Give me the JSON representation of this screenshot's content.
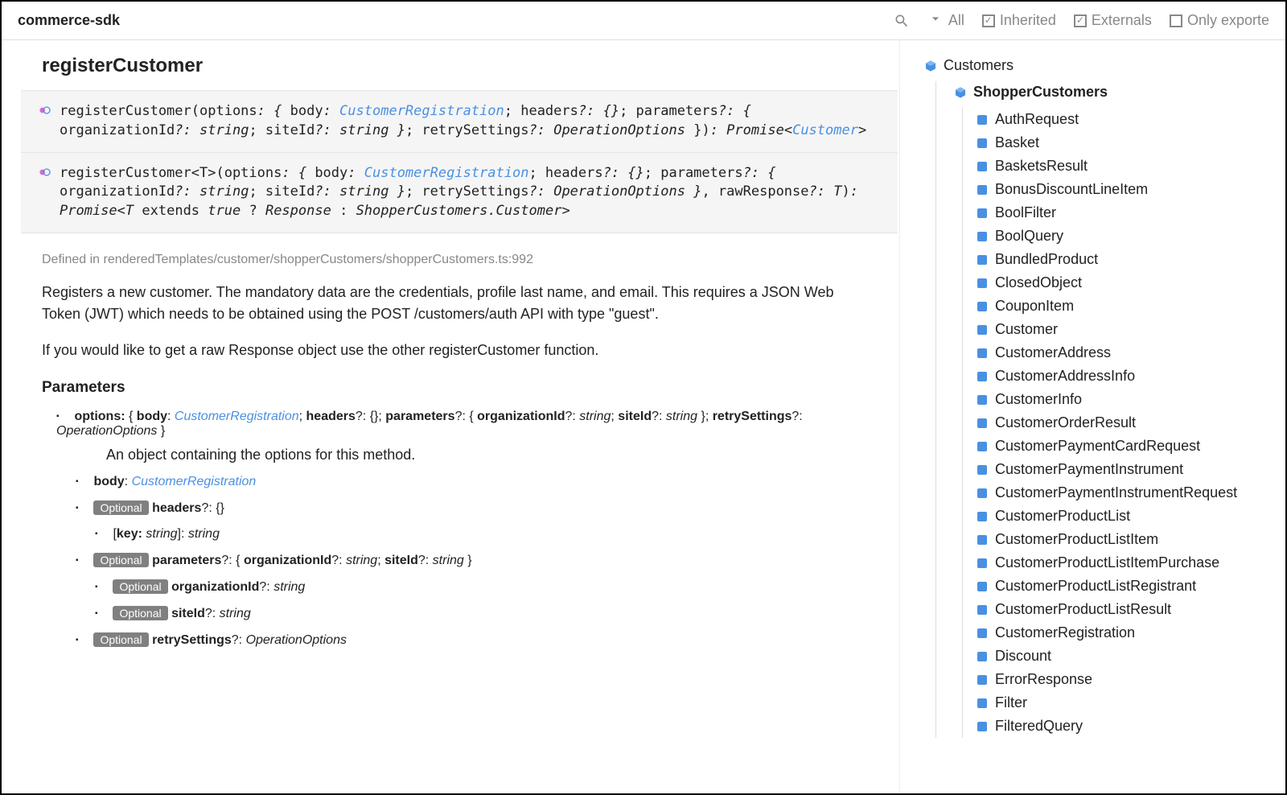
{
  "header": {
    "title": "commerce-sdk",
    "filter_all": "All",
    "filter_inherited": "Inherited",
    "filter_externals": "Externals",
    "filter_only_exported": "Only exporte"
  },
  "method": {
    "title": "registerCustomer",
    "defined_in": "Defined in renderedTemplates/customer/shopperCustomers/shopperCustomers.ts:992",
    "desc1": "Registers a new customer. The mandatory data are the credentials, profile last name, and email. This requires a JSON Web Token (JWT) which needs to be obtained using the POST /customers/auth API with type \"guest\".",
    "desc2": "If you would like to get a raw Response object use the other registerCustomer function.",
    "params_heading": "Parameters"
  },
  "sig1": {
    "p1": "registerCustomer",
    "p2": "(options",
    "p3": ": { ",
    "p4": "body",
    "p5": ": ",
    "link1": "CustomerRegistration",
    "p6": "; headers",
    "p7": "?: {}",
    "p8": "; parameters",
    "p9": "?: { ",
    "p10": "organizationId",
    "p11": "?: ",
    "t_string": "string",
    "p12": "; siteId",
    "p13": "?: ",
    "p14": " }",
    "p15": "; retrySettings",
    "p16": "?: ",
    "t_oo": "OperationOptions",
    "p17": " })",
    "p18": ": ",
    "t_promise": "Promise",
    "p19": "<",
    "link2": "Customer",
    "p20": ">"
  },
  "sig2": {
    "p1": "registerCustomer<T>",
    "p2": "(options",
    "p3": ": { ",
    "p4": "body",
    "p5": ": ",
    "link1": "CustomerRegistration",
    "p6": "; headers",
    "p7": "?: {}",
    "p8": "; parameters",
    "p9": "?: { ",
    "p10": "organizationId",
    "p11": "?: ",
    "t_string": "string",
    "p12": "; siteId",
    "p13": "?: ",
    "p14": " }",
    "p15": "; retrySettings",
    "p16": "?: ",
    "t_oo": "OperationOptions",
    "p17": " }",
    "p18": ", rawResponse",
    "p19": "?: ",
    "t_T": "T",
    "p20": ")",
    "p21": ": ",
    "t_promise": "Promise",
    "p22": "<",
    "p23": "T",
    "p24": " extends ",
    "p25": "true",
    "p26": " ? ",
    "p27": "Response",
    "p28": " : ",
    "p29": "ShopperCustomers.Customer",
    "p30": ">"
  },
  "params": {
    "options": "options: ",
    "brace_open": "{ ",
    "body_k": "body",
    "colon_sp": ": ",
    "body_type": "CustomerRegistration",
    "semi": "; ",
    "headers_k": "headers",
    "q_colon": "?: ",
    "empty_obj": "{}",
    "parameters_k": "parameters",
    "orgid_k": "organizationId",
    "string_t": "string",
    "siteid_k": "siteId",
    "brace_close": " }",
    "retry_k": "retrySettings",
    "oo_t": "OperationOptions",
    "options_desc": "An object containing the options for this method.",
    "optional_badge": "Optional",
    "key_k": "key: ",
    "bracket_open": "[",
    "bracket_close": "]"
  },
  "sidebar": {
    "group0": "Customers",
    "group1": "ShopperCustomers",
    "items": [
      "AuthRequest",
      "Basket",
      "BasketsResult",
      "BonusDiscountLineItem",
      "BoolFilter",
      "BoolQuery",
      "BundledProduct",
      "ClosedObject",
      "CouponItem",
      "Customer",
      "CustomerAddress",
      "CustomerAddressInfo",
      "CustomerInfo",
      "CustomerOrderResult",
      "CustomerPaymentCardRequest",
      "CustomerPaymentInstrument",
      "CustomerPaymentInstrumentRequest",
      "CustomerProductList",
      "CustomerProductListItem",
      "CustomerProductListItemPurchase",
      "CustomerProductListRegistrant",
      "CustomerProductListResult",
      "CustomerRegistration",
      "Discount",
      "ErrorResponse",
      "Filter",
      "FilteredQuery"
    ]
  }
}
